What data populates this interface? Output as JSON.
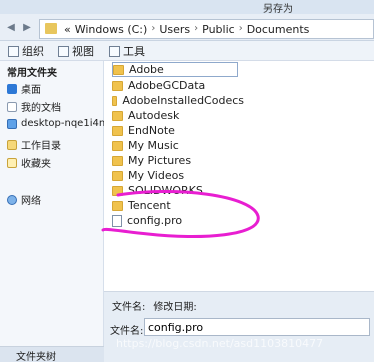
{
  "window": {
    "title": "另存为"
  },
  "nav": {
    "back_glyph": "◀",
    "forward_glyph": "▶"
  },
  "address": {
    "prefix": "«",
    "crumbs": [
      "Windows (C:)",
      "Users",
      "Public",
      "Documents"
    ],
    "separator": "›"
  },
  "toolbar": {
    "organize": "组织",
    "views": "视图",
    "tools": "工具"
  },
  "sidebar": {
    "heading": "常用文件夹",
    "items": [
      "桌面",
      "我的文档",
      "desktop-nqe1i4n",
      "工作目录",
      "收藏夹",
      "网络"
    ],
    "footer": "文件夹树"
  },
  "files": [
    {
      "name": "Adobe",
      "type": "folder"
    },
    {
      "name": "AdobeGCData",
      "type": "folder"
    },
    {
      "name": "AdobeInstalledCodecs",
      "type": "folder"
    },
    {
      "name": "Autodesk",
      "type": "folder"
    },
    {
      "name": "EndNote",
      "type": "folder"
    },
    {
      "name": "My Music",
      "type": "folder"
    },
    {
      "name": "My Pictures",
      "type": "folder"
    },
    {
      "name": "My Videos",
      "type": "folder"
    },
    {
      "name": "SOLIDWORKS",
      "type": "folder"
    },
    {
      "name": "Tencent",
      "type": "folder"
    },
    {
      "name": "config.pro",
      "type": "file"
    }
  ],
  "columns": {
    "name": "文件名:",
    "modified": "修改日期:"
  },
  "filename_field": {
    "label": "文件名:",
    "value": "config.pro"
  },
  "watermark": "https://blog.csdn.net/asd1103810477",
  "colors": {
    "annotation": "#e81ed1",
    "folder": "#f0c24d"
  }
}
